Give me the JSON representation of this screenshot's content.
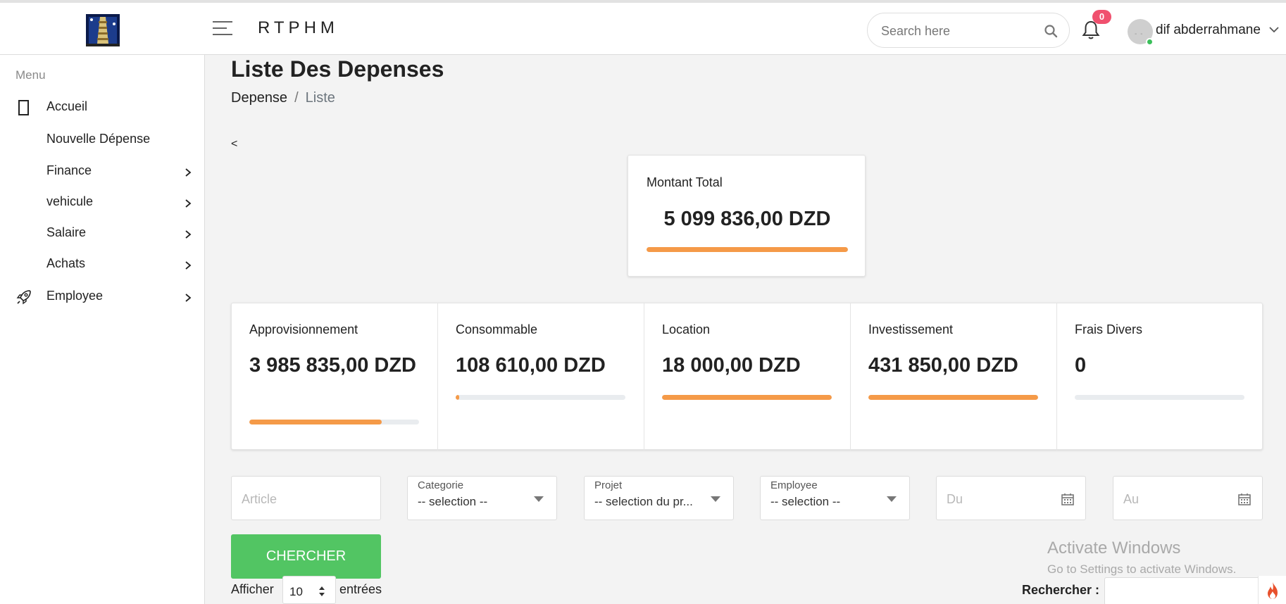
{
  "header": {
    "app_title": "RTPHM",
    "search_placeholder": "Search here",
    "notification_count": "0",
    "user_name": "dif abderrahmane",
    "icons": [
      "logo-image",
      "hamburger-icon",
      "search-icon",
      "bell-icon",
      "avatar",
      "chevron-down-icon"
    ]
  },
  "sidebar": {
    "menu_label": "Menu",
    "items": [
      {
        "label": "Accueil",
        "icon": "mobile-icon",
        "has_submenu": false
      },
      {
        "label": "Nouvelle Dépense",
        "icon": "",
        "has_submenu": false
      },
      {
        "label": "Finance",
        "icon": "",
        "has_submenu": true
      },
      {
        "label": "vehicule",
        "icon": "",
        "has_submenu": true
      },
      {
        "label": "Salaire",
        "icon": "",
        "has_submenu": true
      },
      {
        "label": "Achats",
        "icon": "",
        "has_submenu": true
      },
      {
        "label": "Employee",
        "icon": "rocket-icon",
        "has_submenu": true
      }
    ]
  },
  "page": {
    "title": "Liste Des Depenses",
    "breadcrumb": [
      "Depense",
      "Liste"
    ],
    "back_link": "<"
  },
  "total": {
    "label": "Montant Total",
    "value": "5 099 836,00 DZD",
    "progress": 1.0
  },
  "stats": [
    {
      "label": "Approvisionnement",
      "value": "3 985 835,00 DZD",
      "progress": 0.78
    },
    {
      "label": "Consommable",
      "value": "108 610,00 DZD",
      "progress": 0.02
    },
    {
      "label": "Location",
      "value": "18 000,00 DZD",
      "progress": 1.0
    },
    {
      "label": "Investissement",
      "value": "431 850,00 DZD",
      "progress": 1.0
    },
    {
      "label": "Frais Divers",
      "value": "0",
      "progress": 0.0
    }
  ],
  "filters": {
    "article_placeholder": "Article",
    "categorie": {
      "caption": "Categorie",
      "value": "-- selection --"
    },
    "projet": {
      "caption": "Projet",
      "value": "-- selection du pr..."
    },
    "employee": {
      "caption": "Employee",
      "value": "-- selection --"
    },
    "du_placeholder": "Du",
    "au_placeholder": "Au",
    "search_button": "CHERCHER"
  },
  "table_controls": {
    "show_label": "Afficher",
    "page_size": "10",
    "entries_label": "entrées",
    "search_label": "Rechercher :"
  },
  "watermark": {
    "title": "Activate Windows",
    "subtitle": "Go to Settings to activate Windows."
  },
  "colors": {
    "accent_orange": "#f59a48",
    "button_green": "#52c563",
    "badge_red": "#f0506e",
    "bar_track": "#e9ecef"
  }
}
